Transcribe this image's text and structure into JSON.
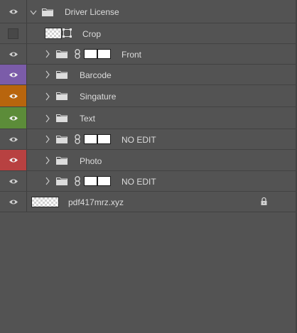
{
  "layers": [
    {
      "name": "Driver License",
      "type": "group",
      "expanded": true,
      "visible": true,
      "eye_color": "",
      "linked_mask": false
    },
    {
      "name": "Crop",
      "type": "artboard-crop",
      "visible": false,
      "eye_color": ""
    },
    {
      "name": "Front",
      "type": "group",
      "expanded": false,
      "visible": true,
      "eye_color": "",
      "linked_mask": true
    },
    {
      "name": "Barcode",
      "type": "group",
      "expanded": false,
      "visible": true,
      "eye_color": "#7b5ca9",
      "linked_mask": false
    },
    {
      "name": "Singature",
      "type": "group",
      "expanded": false,
      "visible": true,
      "eye_color": "#b8650d",
      "linked_mask": false
    },
    {
      "name": "Text",
      "type": "group",
      "expanded": false,
      "visible": true,
      "eye_color": "#5c8c39",
      "linked_mask": false
    },
    {
      "name": "NO EDIT",
      "type": "group",
      "expanded": false,
      "visible": true,
      "eye_color": "",
      "linked_mask": true
    },
    {
      "name": "Photo",
      "type": "group",
      "expanded": false,
      "visible": true,
      "eye_color": "#b84141",
      "linked_mask": false
    },
    {
      "name": "NO EDIT",
      "type": "group",
      "expanded": false,
      "visible": true,
      "eye_color": "",
      "linked_mask": true
    },
    {
      "name": "pdf417mrz.xyz",
      "type": "layer",
      "visible": true,
      "eye_color": "",
      "locked": true
    }
  ],
  "icons": {
    "eye": "eye-icon",
    "hidden": "hidden-eye-icon",
    "folder": "folder-icon",
    "chevron_right": "chevron-right-icon",
    "chevron_down": "chevron-down-icon",
    "link": "link-icon",
    "lock": "lock-icon"
  }
}
